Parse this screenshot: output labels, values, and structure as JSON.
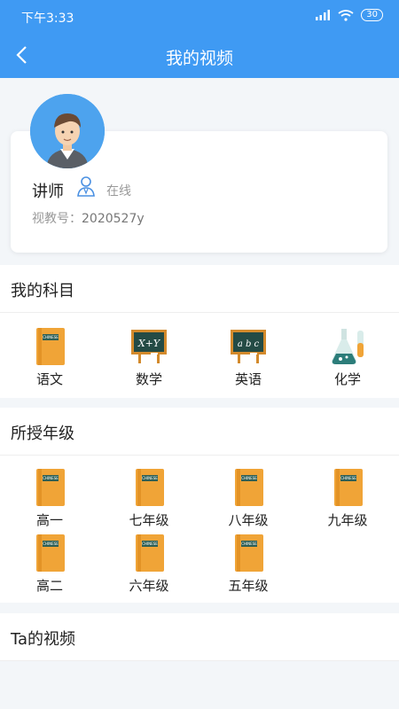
{
  "status": {
    "time": "下午3:33",
    "battery": "30"
  },
  "header": {
    "title": "我的视频"
  },
  "profile": {
    "name": "讲师",
    "status": "在线",
    "id_label": "视教号：",
    "id_value": "2020527y"
  },
  "subjects": {
    "title": "我的科目",
    "items": [
      {
        "label": "语文",
        "icon": "book-icon"
      },
      {
        "label": "数学",
        "icon": "blackboard-math-icon",
        "board_text": "X+Y"
      },
      {
        "label": "英语",
        "icon": "blackboard-english-icon",
        "board_text": "a b c"
      },
      {
        "label": "化学",
        "icon": "chemistry-flask-icon"
      }
    ]
  },
  "grades": {
    "title": "所授年级",
    "items": [
      "高一",
      "七年级",
      "八年级",
      "九年级",
      "高二",
      "六年级",
      "五年级"
    ]
  },
  "videos": {
    "title": "Ta的视频"
  },
  "book_cover_text": "CHINESE"
}
